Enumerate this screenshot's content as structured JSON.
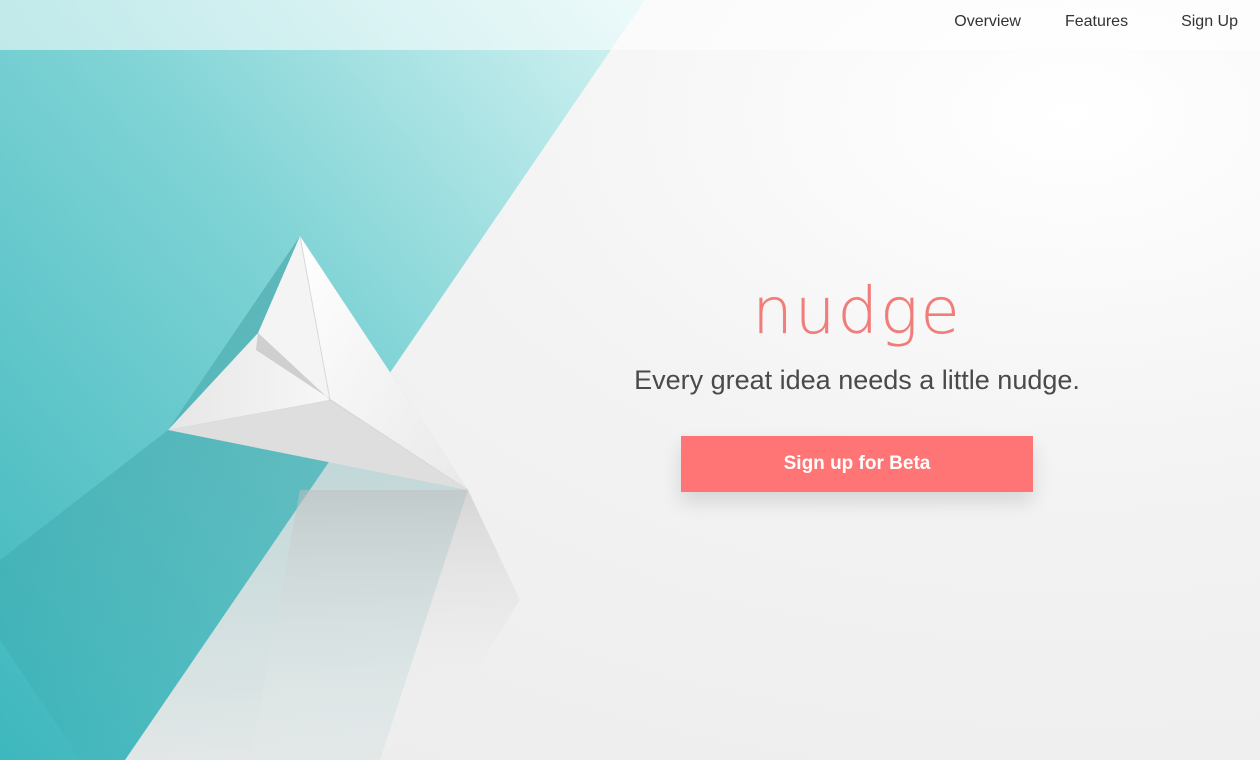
{
  "nav": {
    "items": [
      {
        "label": "Overview"
      },
      {
        "label": "Features"
      },
      {
        "label": "Sign Up"
      }
    ]
  },
  "hero": {
    "brand": "nudge",
    "tagline": "Every great idea needs a little nudge.",
    "cta_label": "Sign up for Beta"
  },
  "colors": {
    "teal": "#4bbfc3",
    "brand": "#f07d7a",
    "cta": "#ff7474",
    "text": "#4a4a4a"
  },
  "icons": {
    "illustration": "paper-plane-icon"
  }
}
